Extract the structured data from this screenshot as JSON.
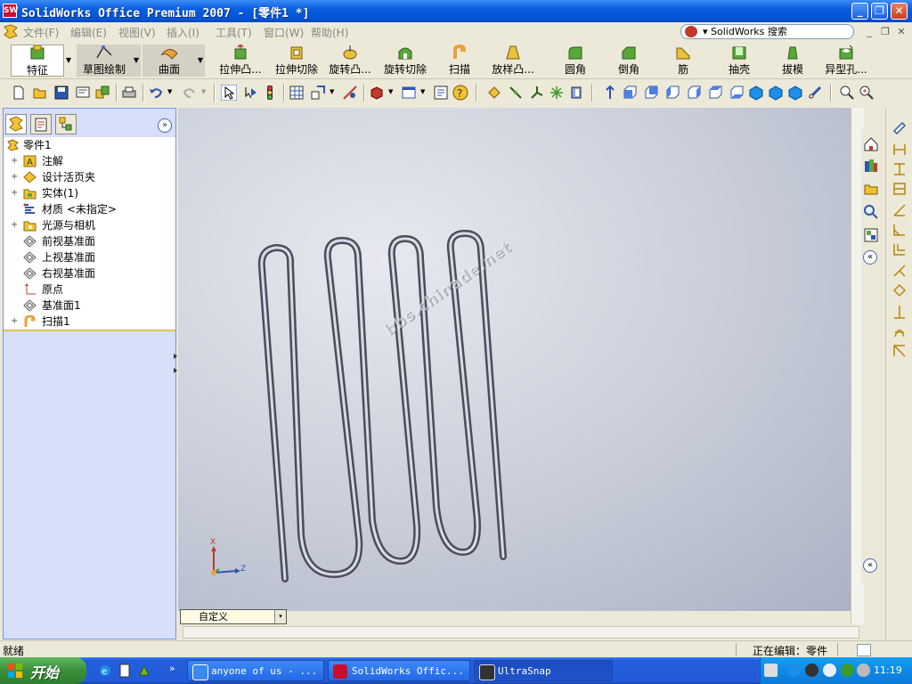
{
  "window": {
    "title": "SolidWorks Office Premium 2007 - [零件1 *]",
    "app_icon_text": "SW",
    "minimize": "_",
    "maximize": "❐",
    "close": "✕"
  },
  "menu": {
    "items": [
      "文件(F)",
      "编辑(E)",
      "视图(V)",
      "插入(I)",
      "工具(T)",
      "窗口(W)",
      "帮助(H)"
    ],
    "search_label": "▾ SolidWorks 搜索",
    "mdi_buttons": [
      "_",
      "❐",
      "✕"
    ]
  },
  "command_manager": {
    "tabs": [
      "特征",
      "草图绘制",
      "曲面"
    ],
    "features": [
      "拉伸凸...",
      "拉伸切除",
      "旋转凸...",
      "旋转切除",
      "扫描",
      "放样凸...",
      "圆角",
      "倒角",
      "筋",
      "抽壳",
      "拔模",
      "异型孔..."
    ]
  },
  "feature_tree": {
    "root": "零件1",
    "items": [
      {
        "label": "注解",
        "expandable": true
      },
      {
        "label": "设计活页夹",
        "expandable": true
      },
      {
        "label": "实体(1)",
        "expandable": true
      },
      {
        "label": "材质 <未指定>",
        "expandable": false
      },
      {
        "label": "光源与相机",
        "expandable": true
      },
      {
        "label": "前视基准面",
        "expandable": false
      },
      {
        "label": "上视基准面",
        "expandable": false
      },
      {
        "label": "右视基准面",
        "expandable": false
      },
      {
        "label": "原点",
        "expandable": false
      },
      {
        "label": "基准面1",
        "expandable": false
      },
      {
        "label": "扫描1",
        "expandable": true
      }
    ],
    "collapse_symbol": "»",
    "expand_symbol": "+"
  },
  "viewport": {
    "watermark": "bbs.chinade.net",
    "triad_labels": {
      "x": "X",
      "z": "Z"
    },
    "config_combo": "自定义",
    "combo_arrow": "▾"
  },
  "taskpane": {
    "collapse_symbol": "«"
  },
  "status": {
    "left": "就绪",
    "right": "正在编辑：零件"
  },
  "taskbar": {
    "start": "开始",
    "tasks": [
      "anyone of us - ...",
      "SolidWorks Offic...",
      "UltraSnap"
    ],
    "quicklaunch_more": "»",
    "clock": "11:19"
  },
  "colors": {
    "titlebar": "#0a5ee0",
    "viewport_bg": "#c7ccd8",
    "part": "#7d8292",
    "tree_divider": "#e6c34a"
  }
}
